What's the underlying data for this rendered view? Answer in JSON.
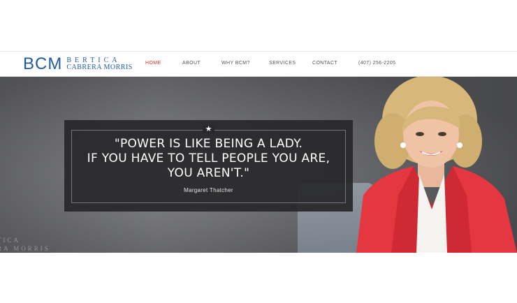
{
  "brand": {
    "mark": "BCM",
    "line1": "BERTICA",
    "line2": "CABRERA MORRIS",
    "color": "#1f5c9e"
  },
  "nav": {
    "items": [
      {
        "label": "HOME",
        "active": true
      },
      {
        "label": "ABOUT",
        "active": false
      },
      {
        "label": "WHY BCM?",
        "active": false
      },
      {
        "label": "SERVICES",
        "active": false
      },
      {
        "label": "CONTACT",
        "active": false
      }
    ],
    "phone": "(407) 256-2205",
    "active_color": "#d42e2e"
  },
  "hero": {
    "quote_lines": [
      "\"POWER IS LIKE BEING A LADY.",
      "IF YOU HAVE TO TELL PEOPLE YOU ARE,",
      "YOU AREN'T.\""
    ],
    "author": "Margaret Thatcher",
    "watermark_line1": "TICA",
    "watermark_line2": "RA MORRIS"
  }
}
